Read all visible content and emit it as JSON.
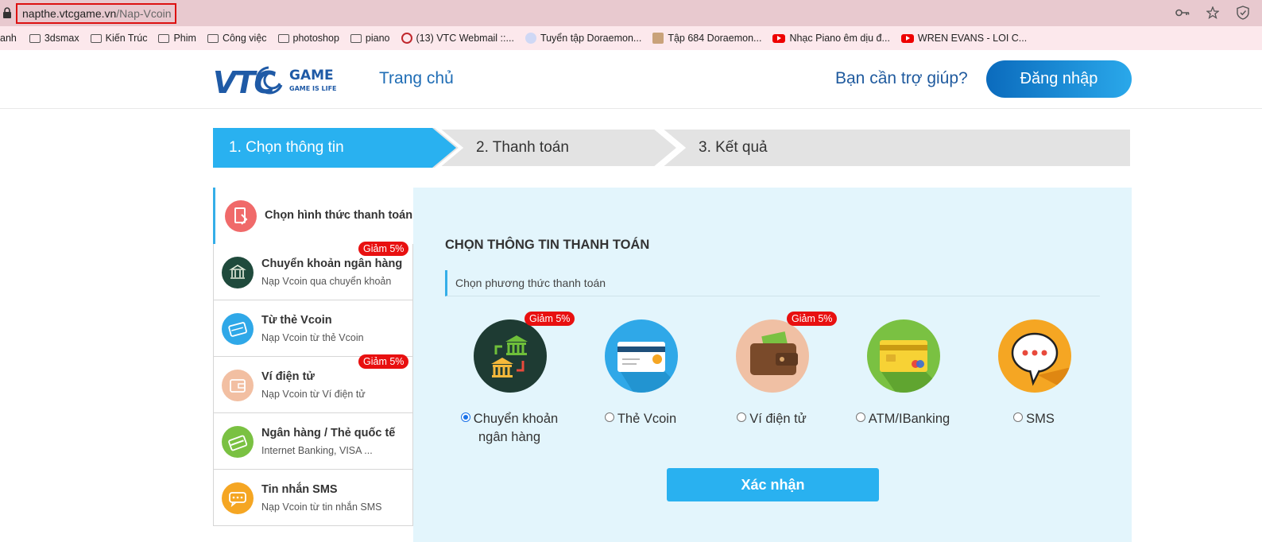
{
  "browser": {
    "url_host": "napthe.vtcgame.vn",
    "url_path": "/Nap-Vcoin",
    "icons": [
      "key-icon",
      "star-icon",
      "shield-icon"
    ]
  },
  "bookmarks": [
    {
      "label": "anh",
      "icon": "none"
    },
    {
      "label": "3dsmax",
      "icon": "folder-icon"
    },
    {
      "label": "Kiến Trúc",
      "icon": "folder-icon"
    },
    {
      "label": "Phim",
      "icon": "folder-icon"
    },
    {
      "label": "Công việc",
      "icon": "folder-icon"
    },
    {
      "label": "photoshop",
      "icon": "folder-icon"
    },
    {
      "label": "piano",
      "icon": "folder-icon"
    },
    {
      "label": "(13) VTC Webmail ::...",
      "icon": "webmail-icon"
    },
    {
      "label": "Tuyển tập Doraemon...",
      "icon": "doraemon-icon"
    },
    {
      "label": "Tập 684 Doraemon...",
      "icon": "thumbnail-icon"
    },
    {
      "label": "Nhạc Piano êm dịu đ...",
      "icon": "youtube-icon"
    },
    {
      "label": "WREN EVANS - LOI C...",
      "icon": "youtube-icon"
    }
  ],
  "header": {
    "nav_home": "Trang chủ",
    "help": "Bạn cần trợ giúp?",
    "login": "Đăng nhập"
  },
  "steps": [
    {
      "label": "1. Chọn thông tin",
      "active": true
    },
    {
      "label": "2. Thanh toán",
      "active": false
    },
    {
      "label": "3. Kết quả",
      "active": false
    }
  ],
  "sidebar": {
    "heading": "Chọn hình thức thanh toán",
    "items": [
      {
        "title": "Chuyển khoản ngân hàng",
        "subtitle": "Nạp Vcoin qua chuyển khoản",
        "badge": "Giảm 5%",
        "color": "#1f4a3c"
      },
      {
        "title": "Từ thẻ Vcoin",
        "subtitle": "Nạp Vcoin từ thẻ Vcoin",
        "badge": "",
        "color": "#2fa8e8"
      },
      {
        "title": "Ví điện tử",
        "subtitle": "Nạp Vcoin từ Ví điện tử",
        "badge": "Giảm 5%",
        "color": "#f2bfa2"
      },
      {
        "title": "Ngân hàng / Thẻ quốc tế",
        "subtitle": "Internet Banking, VISA ...",
        "badge": "",
        "color": "#7ac142"
      },
      {
        "title": "Tin nhắn SMS",
        "subtitle": "Nạp Vcoin từ tin nhắn SMS",
        "badge": "",
        "color": "#f5a623"
      }
    ]
  },
  "main": {
    "title": "CHỌN THÔNG TIN THANH TOÁN",
    "subtitle": "Chọn phương thức thanh toán",
    "methods": [
      {
        "label": "Chuyển khoản ngân hàng",
        "selected": true,
        "badge": "Giảm 5%"
      },
      {
        "label": "Thẻ Vcoin",
        "selected": false,
        "badge": ""
      },
      {
        "label": "Ví điện tử",
        "selected": false,
        "badge": "Giảm 5%"
      },
      {
        "label": "ATM/IBanking",
        "selected": false,
        "badge": ""
      },
      {
        "label": "SMS",
        "selected": false,
        "badge": ""
      }
    ],
    "confirm": "Xác nhận"
  },
  "colors": {
    "accent": "#29b1f0",
    "brand_blue": "#1f6db5",
    "badge_red": "#e81010",
    "panel_bg": "#e3f5fc"
  }
}
